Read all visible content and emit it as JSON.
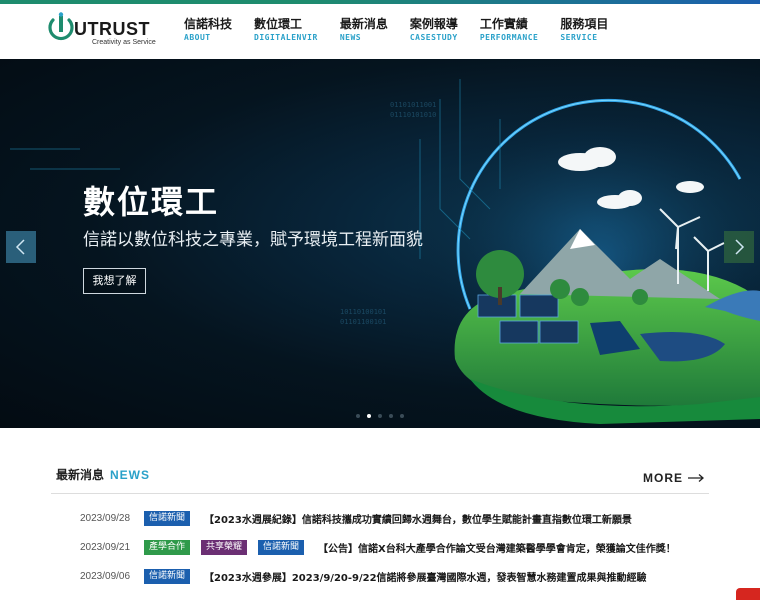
{
  "brand": {
    "name": "UTRUST",
    "tagline": "Creativity as Service",
    "colors": {
      "accent": "#2aa1c9",
      "green": "#1e8c6e",
      "blue": "#1b5fae"
    }
  },
  "nav": {
    "items": [
      {
        "zh": "信諾科技",
        "en": "ABOUT"
      },
      {
        "zh": "數位環工",
        "en": "DIGITALENVIR"
      },
      {
        "zh": "最新消息",
        "en": "NEWS"
      },
      {
        "zh": "案例報導",
        "en": "CASESTUDY"
      },
      {
        "zh": "工作實績",
        "en": "PERFORMANCE"
      },
      {
        "zh": "服務項目",
        "en": "SERVICE"
      }
    ]
  },
  "hero": {
    "title": "數位環工",
    "subtitle": "信諾以數位科技之專業，賦予環境工程新面貌",
    "cta_label": "我想了解",
    "prev_icon": "chevron-left-icon",
    "next_icon": "chevron-right-icon",
    "slide_count": 5,
    "active_slide": 2
  },
  "news": {
    "heading_zh": "最新消息",
    "heading_en": "NEWS",
    "more_label": "MORE",
    "items": [
      {
        "date": "2023/09/28",
        "tags": [
          {
            "label": "信諾新聞",
            "kind": "news"
          }
        ],
        "title": "【2023水週展紀錄】信諾科技攜成功實績回歸水週舞台，數位學生賦能計畫直指數位環工新願景"
      },
      {
        "date": "2023/09/21",
        "tags": [
          {
            "label": "產學合作",
            "kind": "industry"
          },
          {
            "label": "共享榮耀",
            "kind": "honor"
          },
          {
            "label": "信諾新聞",
            "kind": "news"
          }
        ],
        "title": "【公告】信諾X台科大產學合作論文受台灣建築醫學學會肯定，榮獲論文佳作獎！"
      },
      {
        "date": "2023/09/06",
        "tags": [
          {
            "label": "信諾新聞",
            "kind": "news"
          }
        ],
        "title": "【2023水週參展】2023/9/20-9/22信諾將參展臺灣國際水週，發表智慧水務建置成果與推動經驗"
      }
    ]
  }
}
